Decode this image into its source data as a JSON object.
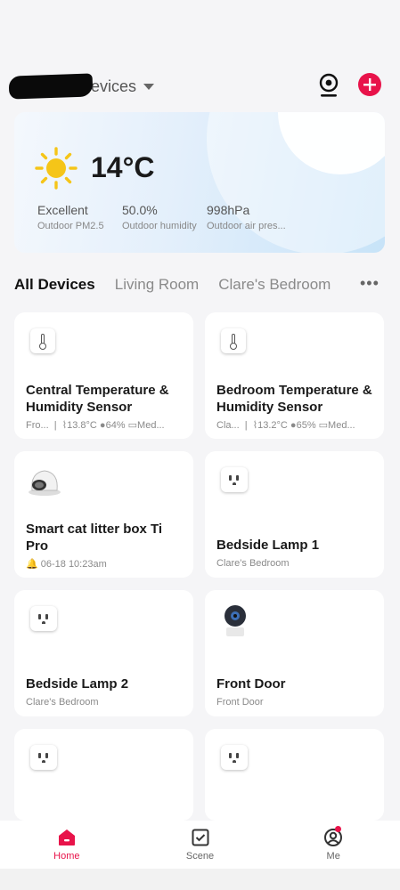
{
  "header": {
    "home_name": "evices",
    "icons": {
      "camera": "camera-icon",
      "add": "add-icon"
    }
  },
  "weather": {
    "temperature": "14°C",
    "metrics": [
      {
        "value": "Excellent",
        "label": "Outdoor PM2.5"
      },
      {
        "value": "50.0%",
        "label": "Outdoor humidity"
      },
      {
        "value": "998hPa",
        "label": "Outdoor air pres..."
      }
    ]
  },
  "tabs": [
    "All Devices",
    "Living Room",
    "Clare's Bedroom"
  ],
  "devices": [
    {
      "name": "Central Temperature & Humidity Sensor",
      "sub": "Fro...  |  ⌇13.8°C ●64% ▭Med...",
      "icon": "thermometer-icon"
    },
    {
      "name": "Bedroom Temperature & Humidity Sensor",
      "sub": "Cla...  |  ⌇13.2°C ●65% ▭Med...",
      "icon": "thermometer-icon"
    },
    {
      "name": "Smart cat litter box Ti Pro",
      "sub": "🔔 06-18 10:23am",
      "icon": "litter-box-icon"
    },
    {
      "name": "Bedside Lamp 1",
      "sub": "Clare's Bedroom",
      "icon": "smart-plug-icon"
    },
    {
      "name": "Bedside Lamp 2",
      "sub": "Clare's Bedroom",
      "icon": "smart-plug-icon"
    },
    {
      "name": "Front Door",
      "sub": "Front Door",
      "icon": "camera-device-icon"
    },
    {
      "name": "",
      "sub": "",
      "icon": "smart-plug-icon"
    },
    {
      "name": "",
      "sub": "",
      "icon": "smart-plug-icon"
    }
  ],
  "nav": [
    {
      "label": "Home",
      "icon": "home-icon"
    },
    {
      "label": "Scene",
      "icon": "scene-icon"
    },
    {
      "label": "Me",
      "icon": "profile-icon"
    }
  ],
  "colors": {
    "accent": "#e8134a",
    "background": "#f5f5f7"
  }
}
